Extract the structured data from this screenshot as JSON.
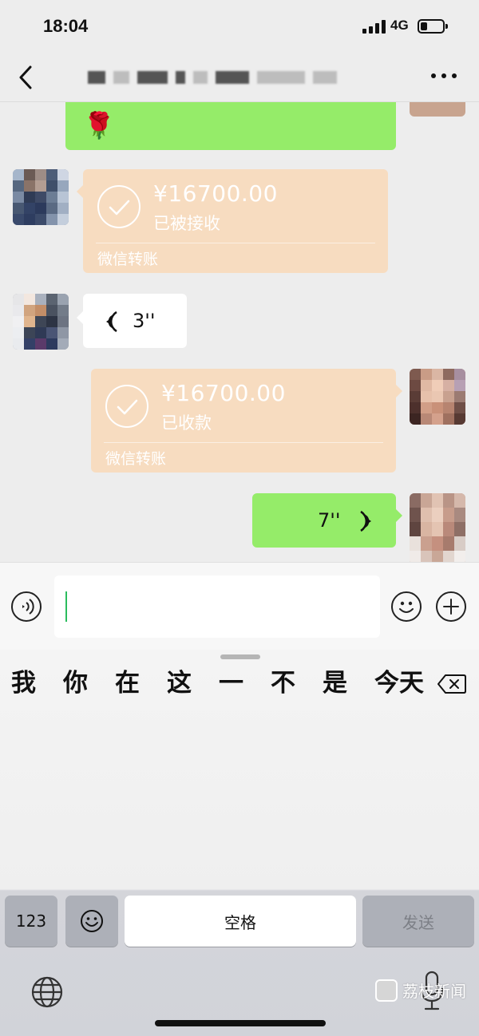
{
  "status_bar": {
    "time": "18:04",
    "network": "4G"
  },
  "nav": {
    "back_icon": "chevron-left-icon",
    "more_icon": "ellipsis-icon"
  },
  "messages": {
    "rose_emoji": "🌹",
    "transfer_1": {
      "amount": "¥16700.00",
      "status": "已被接收",
      "label": "微信转账"
    },
    "voice_in": {
      "duration": "3''"
    },
    "transfer_2": {
      "amount": "¥16700.00",
      "status": "已收款",
      "label": "微信转账"
    },
    "voice_out": {
      "duration": "7''"
    }
  },
  "keyboard": {
    "candidates": [
      "我",
      "你",
      "在",
      "这",
      "一",
      "不",
      "是",
      "今天"
    ],
    "numbers_key": "123",
    "space_key": "空格",
    "send_key": "发送"
  },
  "watermark": {
    "text": "荔枝新闻"
  },
  "colors": {
    "wechat_green": "#95ec69",
    "transfer_orange": "#f7dcc0",
    "background": "#ededed"
  }
}
